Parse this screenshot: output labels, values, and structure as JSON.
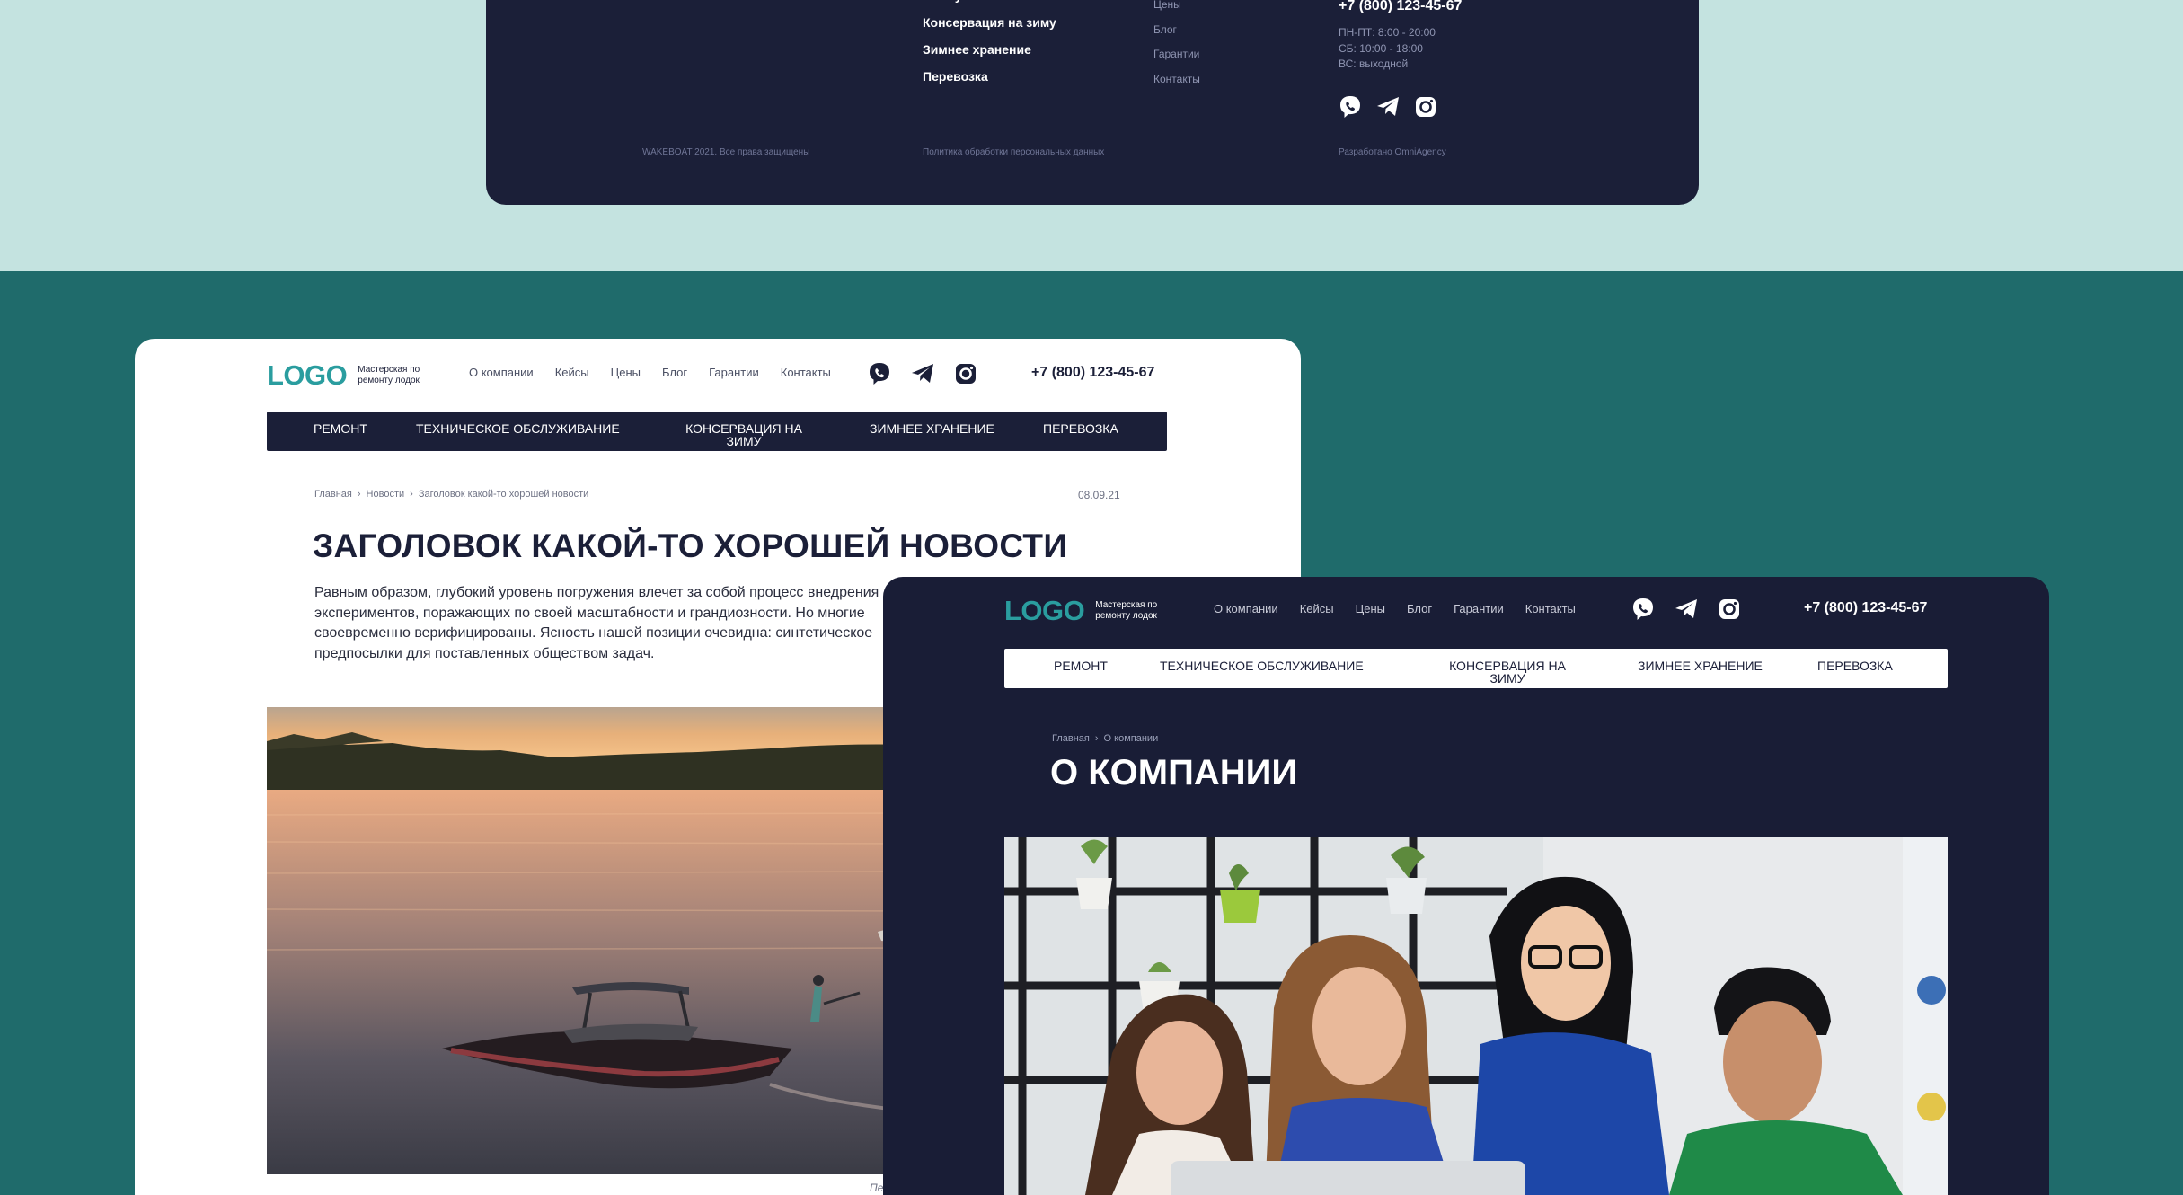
{
  "colors": {
    "accent": "#2a9d9f",
    "navy": "#1b1f38",
    "mint": "#c4e3e0",
    "teal": "#1f6b6b"
  },
  "footer": {
    "services": [
      "Обслуживание",
      "Консервация на зиму",
      "Зимнее хранение",
      "Перевозка"
    ],
    "links": [
      "Цены",
      "Блог",
      "Гарантии",
      "Контакты"
    ],
    "phone": "+7 (800) 123-45-67",
    "hours": [
      "ПН-ПТ: 8:00 - 20:00",
      "СБ: 10:00 - 18:00",
      "ВС: выходной"
    ],
    "copyright": "WAKEBOAT 2021. Все права защищены",
    "policy": "Политика обработки персональных данных",
    "developer": "Разработано OmniAgency",
    "icons": [
      "viber-icon",
      "telegram-icon",
      "instagram-icon"
    ]
  },
  "site": {
    "logo": "LOGO",
    "tagline_1": "Мастерская по",
    "tagline_2": "ремонту лодок",
    "nav": [
      "О компании",
      "Кейсы",
      "Цены",
      "Блог",
      "Гарантии",
      "Контакты"
    ],
    "phone": "+7 (800) 123-45-67",
    "categories": [
      "Ремонт",
      "Техническое обслуживание",
      "Консервация на зиму",
      "Зимнее хранение",
      "Перевозка"
    ]
  },
  "news_page": {
    "breadcrumb": [
      "Главная",
      "Новости",
      "Заголовок какой-то хорошей новости"
    ],
    "date": "08.09.21",
    "title": "ЗАГОЛОВОК КАКОЙ-ТО ХОРОШЕЙ НОВОСТИ",
    "body_lines": [
      "Равным образом, глубокий уровень погружения влечет за собой процесс внедрения",
      "экспериментов, поражающих по своей масштабности и грандиозности. Но многие",
      "своевременно верифицированы. Ясность нашей позиции очевидна: синтетическое",
      "предпосылки для поставленных обществом задач."
    ],
    "caption": "Пе"
  },
  "about_page": {
    "breadcrumb": [
      "Главная",
      "О компании"
    ],
    "title": "О КОМПАНИИ"
  }
}
